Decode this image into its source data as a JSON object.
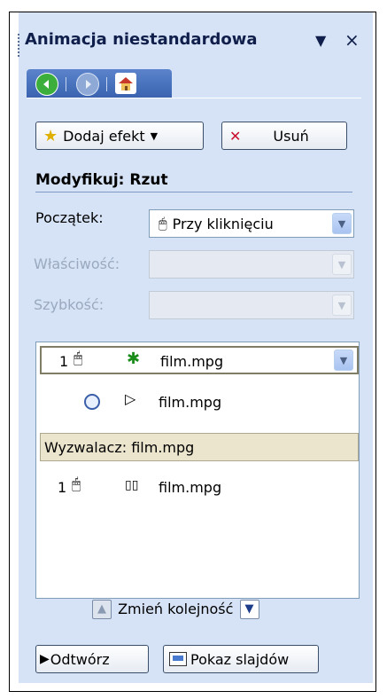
{
  "panel": {
    "title": "Animacja niestandardowa",
    "dropdown_glyph": "▼",
    "close_glyph": "×"
  },
  "nav": {
    "back_icon": "back-arrow-icon",
    "forward_icon": "forward-arrow-icon",
    "home_icon": "home-icon"
  },
  "toolbar": {
    "add_effect_label": "Dodaj efekt",
    "remove_label": "Usuń"
  },
  "modify": {
    "heading": "Modyfikuj: Rzut",
    "start_label": "Początek:",
    "start_value": "Przy kliknięciu",
    "property_label": "Właściwość:",
    "speed_label": "Szybkość:"
  },
  "effects": {
    "items": [
      {
        "number": "1",
        "text": "film.mpg",
        "icon": "green-star-icon",
        "trigger": "mouse-icon"
      },
      {
        "number": "",
        "text": "film.mpg",
        "icon": "play-icon",
        "trigger": "clock-icon"
      }
    ],
    "trigger_label": "Wyzwalacz: film.mpg",
    "trigger_items": [
      {
        "number": "1",
        "text": "film.mpg",
        "icon": "pause-icon",
        "trigger": "mouse-icon"
      }
    ]
  },
  "reorder": {
    "label": "Zmień kolejność"
  },
  "footer": {
    "play_label": "Odtwórz",
    "slideshow_label": "Pokaz slajdów"
  },
  "colors": {
    "pane_bg": "#d6e3f6",
    "title_text": "#0f1e4a",
    "nav_bar": "#4a74c0",
    "selected_border": "#807c66",
    "trigger_bg": "#ebe5cd"
  }
}
